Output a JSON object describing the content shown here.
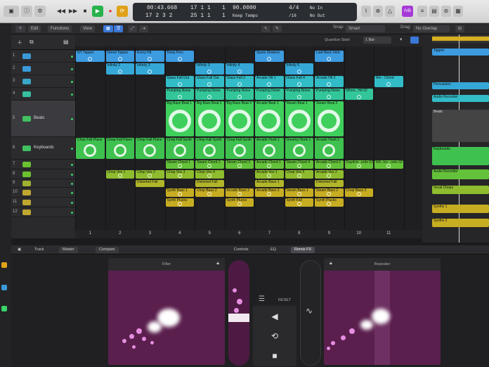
{
  "transport": {
    "time_top": "00:43.668",
    "time_bottom": "17 2 3 2",
    "bars_top": "17 1 1",
    "bars_one": "1",
    "bars_bottom": "25 1 1",
    "tempo": "90.0000",
    "tempo_label": "Keep Tempo",
    "sig_top": "4/4",
    "sig_bottom": "/16",
    "key_top": "No In",
    "key_bottom": "No Out"
  },
  "top_badge": "IVB",
  "toolbar": {
    "edit": "Edit",
    "functions": "Functions",
    "view": "View",
    "snap_label": "Snap:",
    "snap_value": "Smart",
    "drag_label": "Drag:",
    "drag_value": "No Overlap",
    "quantize_label": "Quantize Start:",
    "quantize_value": "1 Bar"
  },
  "tracks": [
    {
      "num": "1",
      "name": "",
      "color": "#3a9ad8"
    },
    {
      "num": "2",
      "name": "",
      "color": "#3a9ad8"
    },
    {
      "num": "3",
      "name": "",
      "color": "#3aa6c8"
    },
    {
      "num": "4",
      "name": "",
      "color": "#37c0a0"
    },
    {
      "num": "5",
      "name": "Beats",
      "color": "#40c060"
    },
    {
      "num": "6",
      "name": "Keyboards",
      "color": "#40c060"
    },
    {
      "num": "7",
      "name": "",
      "color": "#6bc030"
    },
    {
      "num": "8",
      "name": "",
      "color": "#6bc030"
    },
    {
      "num": "9",
      "name": "",
      "color": "#a0b030"
    },
    {
      "num": "10",
      "name": "",
      "color": "#c0a830"
    },
    {
      "num": "11",
      "name": "",
      "color": "#c0a830"
    },
    {
      "num": "12",
      "name": "",
      "color": "#c0a830"
    }
  ],
  "cells": [
    {
      "lbl": "NY Tapper",
      "col": 0,
      "row": 0,
      "color": "#3d9be0"
    },
    {
      "lbl": "Ghost Tapper",
      "col": 1,
      "row": 0,
      "color": "#3d9be0"
    },
    {
      "lbl": "Every Hit",
      "col": 2,
      "row": 0,
      "color": "#3d9be0"
    },
    {
      "lbl": "Deep Perc",
      "col": 3,
      "row": 0,
      "color": "#3d9be0"
    },
    {
      "lbl": "Spare Shakers",
      "col": 6,
      "row": 0,
      "color": "#3d9be0"
    },
    {
      "lbl": "Laid Back Verb",
      "col": 8,
      "row": 0,
      "color": "#3d9be0"
    },
    {
      "lbl": "Infinity 2",
      "col": 1,
      "row": 1,
      "color": "#35a8d8"
    },
    {
      "lbl": "Infinity 3",
      "col": 2,
      "row": 1,
      "color": "#35a8d8"
    },
    {
      "lbl": "Infinity 3",
      "col": 4,
      "row": 1,
      "color": "#35a8d8"
    },
    {
      "lbl": "Infinity 4",
      "col": 5,
      "row": 1,
      "color": "#35a8d8"
    },
    {
      "lbl": "Infinity 5",
      "col": 7,
      "row": 1,
      "color": "#35a8d8"
    },
    {
      "lbl": "Glass Fall Out",
      "col": 3,
      "row": 2,
      "color": "#32bcc8"
    },
    {
      "lbl": "Glass Fall Out",
      "col": 4,
      "row": 2,
      "color": "#32bcc8"
    },
    {
      "lbl": "Glass Fall 3",
      "col": 5,
      "row": 2,
      "color": "#32bcc8"
    },
    {
      "lbl": "Arcade Hit 1",
      "col": 6,
      "row": 2,
      "color": "#32bcc8"
    },
    {
      "lbl": "Glass Fall 4",
      "col": 7,
      "row": 2,
      "color": "#32bcc8"
    },
    {
      "lbl": "Arcade Hit 2",
      "col": 8,
      "row": 2,
      "color": "#32bcc8"
    },
    {
      "lbl": "Am - Chord",
      "col": 10,
      "row": 2,
      "color": "#32bcc8"
    },
    {
      "lbl": "Pumping Noise",
      "col": 3,
      "row": 3,
      "color": "#33c69b"
    },
    {
      "lbl": "Pumping Noise",
      "col": 4,
      "row": 3,
      "color": "#33c69b"
    },
    {
      "lbl": "Pumping Noise",
      "col": 5,
      "row": 3,
      "color": "#33c69b"
    },
    {
      "lbl": "Pumping Noise",
      "col": 6,
      "row": 3,
      "color": "#33c69b"
    },
    {
      "lbl": "Pumping Noise",
      "col": 7,
      "row": 3,
      "color": "#33c69b"
    },
    {
      "lbl": "Pumping Noise",
      "col": 8,
      "row": 3,
      "color": "#33c69b"
    },
    {
      "lbl": "Whoo...Hit 02",
      "col": 9,
      "row": 3,
      "color": "#33c69b"
    },
    {
      "lbl": "Big Bass Beat 1",
      "col": 3,
      "row": 4,
      "color": "#3fcf5c"
    },
    {
      "lbl": "Big Bass Beat 2",
      "col": 4,
      "row": 4,
      "color": "#3fcf5c"
    },
    {
      "lbl": "Big Bass Beat 3",
      "col": 5,
      "row": 4,
      "color": "#3fcf5c"
    },
    {
      "lbl": "Arcade Beat 1",
      "col": 6,
      "row": 4,
      "color": "#3fcf5c"
    },
    {
      "lbl": "Steam Beat 1",
      "col": 7,
      "row": 4,
      "color": "#3fcf5c"
    },
    {
      "lbl": "Steam Beat 2",
      "col": 8,
      "row": 4,
      "color": "#3fcf5c"
    },
    {
      "lbl": "Chop Fall Piano",
      "col": 0,
      "row": 5,
      "color": "#3ec14e"
    },
    {
      "lbl": "Chop Fall Piano",
      "col": 1,
      "row": 5,
      "color": "#3ec14e"
    },
    {
      "lbl": "Chop Fall Piano",
      "col": 2,
      "row": 5,
      "color": "#3ec14e"
    },
    {
      "lbl": "Chop Fall Synth",
      "col": 3,
      "row": 5,
      "color": "#3ec14e"
    },
    {
      "lbl": "Chop Fall Synth",
      "col": 4,
      "row": 5,
      "color": "#3ec14e"
    },
    {
      "lbl": "Chop Fall Synth",
      "col": 5,
      "row": 5,
      "color": "#3ec14e"
    },
    {
      "lbl": "Arcade Hook 1",
      "col": 6,
      "row": 5,
      "color": "#3ec14e"
    },
    {
      "lbl": "Dreamy Hook 1",
      "col": 7,
      "row": 5,
      "color": "#3ec14e"
    },
    {
      "lbl": "Arcade Hook 2",
      "col": 8,
      "row": 5,
      "color": "#3ec14e"
    },
    {
      "lbl": "Steam Chord 1",
      "col": 3,
      "row": 6,
      "color": "#64c23a"
    },
    {
      "lbl": "Steam Chord 2",
      "col": 4,
      "row": 6,
      "color": "#64c23a"
    },
    {
      "lbl": "Steam Chord 3",
      "col": 5,
      "row": 6,
      "color": "#64c23a"
    },
    {
      "lbl": "Arcade Chord 1",
      "col": 6,
      "row": 6,
      "color": "#64c23a"
    },
    {
      "lbl": "Steam Chord 4",
      "col": 7,
      "row": 6,
      "color": "#64c23a"
    },
    {
      "lbl": "Arcade Chord 2",
      "col": 8,
      "row": 6,
      "color": "#64c23a"
    },
    {
      "lbl": "Daydrm...ords 01",
      "col": 9,
      "row": 6,
      "color": "#64c23a"
    },
    {
      "lbl": "Wh..Inc...ords 02",
      "col": 10,
      "row": 6,
      "color": "#64c23a"
    },
    {
      "lbl": "Chop Vox 1",
      "col": 1,
      "row": 7,
      "color": "#8ebc2e"
    },
    {
      "lbl": "Chop Vox 2",
      "col": 2,
      "row": 7,
      "color": "#8ebc2e"
    },
    {
      "lbl": "Chop Vox 3",
      "col": 3,
      "row": 7,
      "color": "#8ebc2e"
    },
    {
      "lbl": "Chop Vox 4",
      "col": 4,
      "row": 7,
      "color": "#8ebc2e"
    },
    {
      "lbl": "Arcade Vox 1",
      "col": 6,
      "row": 7,
      "color": "#8ebc2e"
    },
    {
      "lbl": "Chop Vox 5",
      "col": 7,
      "row": 7,
      "color": "#8ebc2e"
    },
    {
      "lbl": "Arcade Vox 2",
      "col": 8,
      "row": 7,
      "color": "#8ebc2e"
    },
    {
      "lbl": "Distorted Fall",
      "col": 2,
      "row": 8,
      "color": "#b1b52a"
    },
    {
      "lbl": "Distorted Fall",
      "col": 4,
      "row": 8,
      "color": "#b1b52a"
    },
    {
      "lbl": "Arcade Bass 1",
      "col": 6,
      "row": 8,
      "color": "#b1b52a"
    },
    {
      "lbl": "Distorted Fall",
      "col": 8,
      "row": 8,
      "color": "#b1b52a"
    },
    {
      "lbl": "Synth Bass 1",
      "col": 3,
      "row": 9,
      "color": "#c7ad22"
    },
    {
      "lbl": "Chop Bass 2",
      "col": 4,
      "row": 9,
      "color": "#c7ad22"
    },
    {
      "lbl": "Arcade Bass 2",
      "col": 5,
      "row": 9,
      "color": "#c7ad22"
    },
    {
      "lbl": "Arcade Bass 3",
      "col": 6,
      "row": 9,
      "color": "#c7ad22"
    },
    {
      "lbl": "Steam Bass 1",
      "col": 7,
      "row": 9,
      "color": "#c7ad22"
    },
    {
      "lbl": "Steam Bass 2",
      "col": 8,
      "row": 9,
      "color": "#c7ad22"
    },
    {
      "lbl": "Chop Bass 3",
      "col": 9,
      "row": 9,
      "color": "#c7ad22"
    },
    {
      "lbl": "Synth Plucks",
      "col": 3,
      "row": 10,
      "color": "#c7ad22"
    },
    {
      "lbl": "Synth Plucks",
      "col": 5,
      "row": 10,
      "color": "#c7ad22"
    },
    {
      "lbl": "Synth Fall",
      "col": 7,
      "row": 10,
      "color": "#c7ad22"
    },
    {
      "lbl": "Synth Plucks",
      "col": 8,
      "row": 10,
      "color": "#c7ad22"
    }
  ],
  "scenes": [
    "1",
    "2",
    "3",
    "4",
    "5",
    "6",
    "7",
    "8",
    "9",
    "10",
    "11"
  ],
  "rightpanel": {
    "lanes": [
      {
        "label": "Tapper",
        "color": "#3d9be0"
      },
      {
        "label": "Percussion",
        "color": "#35a8d8"
      },
      {
        "label": "Audio Recorder",
        "color": "#32bcc8"
      },
      {
        "label": "Beats",
        "color": "#3fcf5c"
      },
      {
        "label": "Keyboards",
        "color": "#3ec14e"
      },
      {
        "label": "Audio Recorder",
        "color": "#64c23a"
      },
      {
        "label": "Vocal Chops",
        "color": "#8ebc2e"
      },
      {
        "label": "Synths 1",
        "color": "#c7ad22"
      },
      {
        "label": "Synths 2",
        "color": "#c7ad22"
      }
    ]
  },
  "inspector": {
    "track_tab": "Track",
    "master_tab": "Master",
    "compare_tab": "Compare",
    "controls_tab": "Controls",
    "eq_tab": "EQ",
    "remixfx_tab": "Remix FX",
    "left_pad_title": "Filter",
    "right_pad_title": "Repeater",
    "reset": "RESET"
  }
}
